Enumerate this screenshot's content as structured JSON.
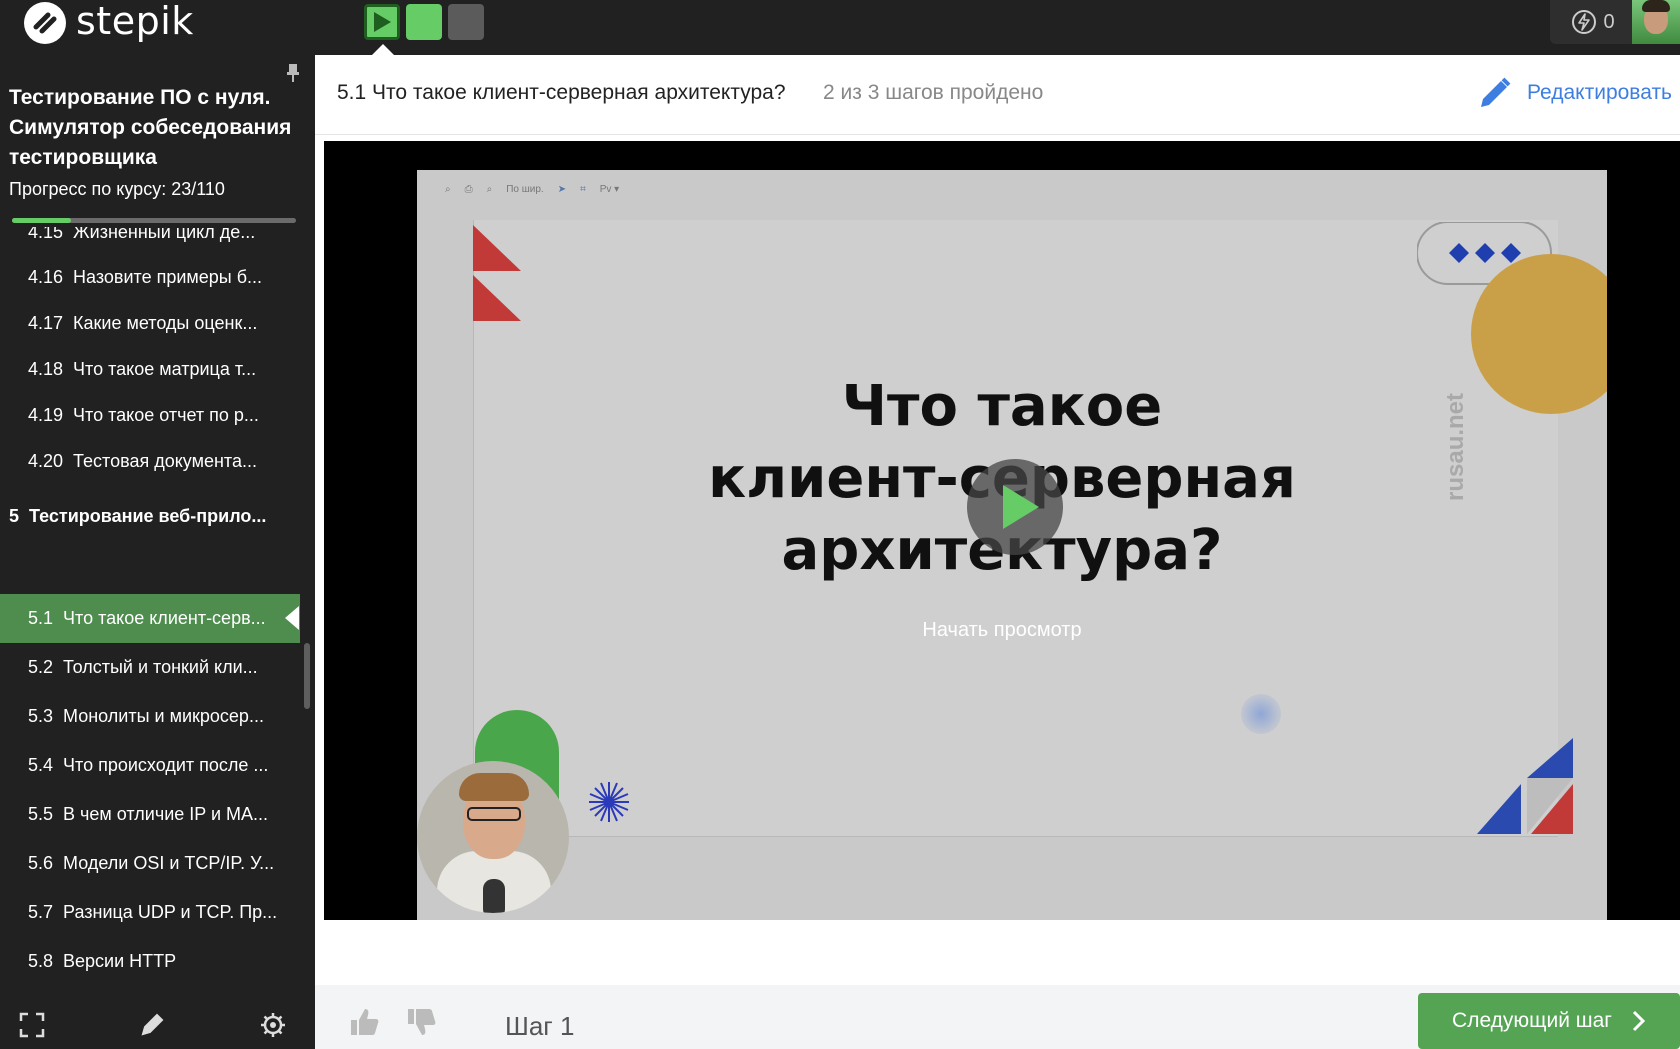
{
  "topbar": {
    "logo_text": "stepik",
    "energy_count": "0",
    "step_squares": [
      "active",
      "done",
      "todo"
    ]
  },
  "sidebar": {
    "course_title": "Тестирование ПО с нуля. Симулятор собеседования тестировщика",
    "progress_label": "Прогресс по курсу:",
    "progress_value": "23/110",
    "progress_fraction": 0.209,
    "lessons_before": [
      {
        "num": "4.15",
        "title": "Жизненный цикл де..."
      },
      {
        "num": "4.16",
        "title": "Назовите примеры б..."
      },
      {
        "num": "4.17",
        "title": "Какие методы оценк..."
      },
      {
        "num": "4.18",
        "title": "Что такое матрица т..."
      },
      {
        "num": "4.19",
        "title": "Что такое отчет по р..."
      },
      {
        "num": "4.20",
        "title": "Тестовая документа..."
      }
    ],
    "section": {
      "num": "5",
      "title": "Тестирование веб-прило..."
    },
    "lessons_after": [
      {
        "num": "5.1",
        "title": "Что такое клиент-серв..."
      },
      {
        "num": "5.2",
        "title": "Толстый и тонкий кли..."
      },
      {
        "num": "5.3",
        "title": "Монолиты и микросер..."
      },
      {
        "num": "5.4",
        "title": "Что происходит после ..."
      },
      {
        "num": "5.5",
        "title": "В чем отличие IP и MA..."
      },
      {
        "num": "5.6",
        "title": "Модели OSI и TCP/IP. У..."
      },
      {
        "num": "5.7",
        "title": "Разница UDP и TCP. Пр..."
      },
      {
        "num": "5.8",
        "title": "Версии HTTP"
      }
    ]
  },
  "lesson": {
    "title": "5.1 Что такое клиент-серверная архитектура?",
    "steps_status": "2 из 3 шагов пройдено",
    "edit_label": "Редактировать"
  },
  "video": {
    "title_line1": "Что такое",
    "title_line2": "клиент-серверная",
    "title_line3": "архитектура?",
    "start_label": "Начать просмотр",
    "watermark": "rusau.net",
    "toolbar_zoom": "По шир."
  },
  "footer": {
    "step_label": "Шаг 1",
    "next_label": "Следующий шаг"
  },
  "colors": {
    "accent_green": "#66cc66",
    "link_blue": "#3d7ee0",
    "sidebar_bg": "#212121"
  }
}
